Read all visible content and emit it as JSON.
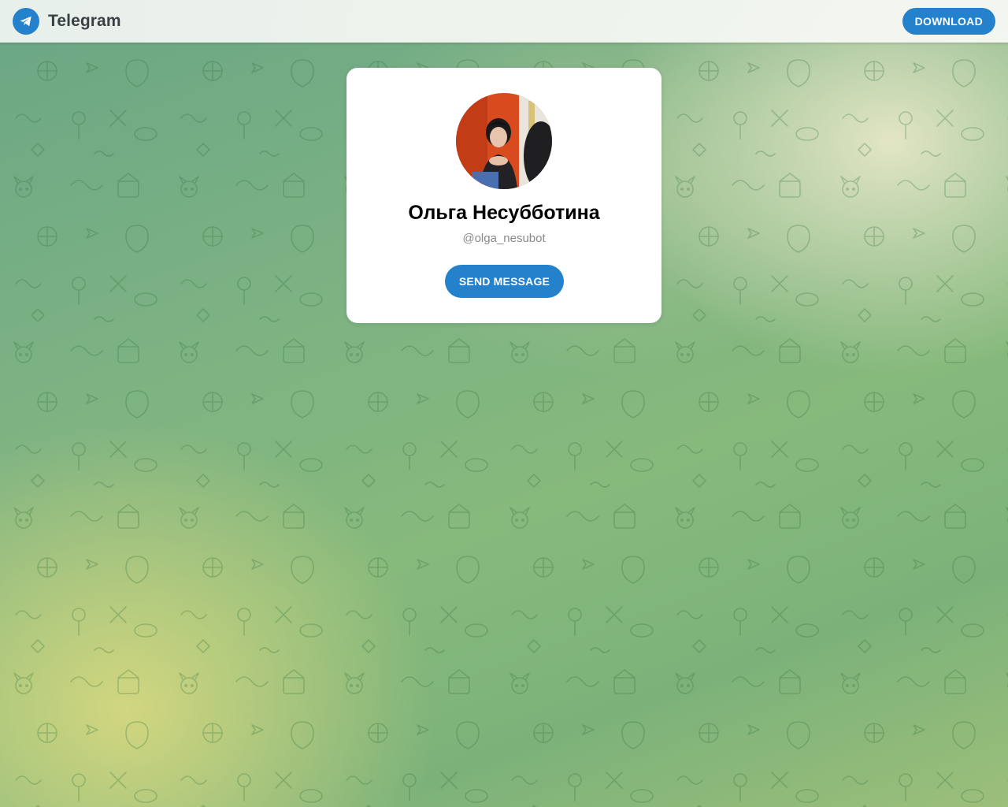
{
  "header": {
    "app_name": "Telegram",
    "logo_icon": "telegram-paper-plane-icon",
    "download_label": "DOWNLOAD"
  },
  "profile": {
    "name": "Ольга Несубботина",
    "username": "@olga_nesubot",
    "send_message_label": "SEND MESSAGE"
  },
  "colors": {
    "accent": "#2481cc",
    "card_bg": "#ffffff",
    "username_gray": "#8a8a8a"
  }
}
